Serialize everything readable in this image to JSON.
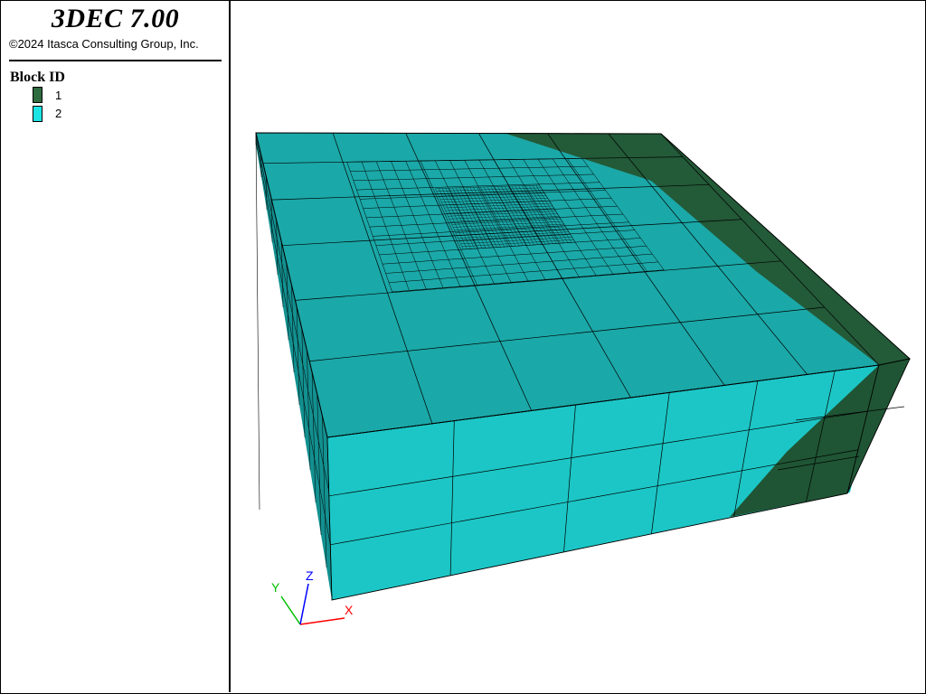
{
  "app": {
    "title": "3DEC 7.00",
    "copyright": "©2024 Itasca Consulting Group, Inc."
  },
  "legend": {
    "title": "Block  ID",
    "items": [
      {
        "label": "1",
        "color": "#2e6b3f"
      },
      {
        "label": "2",
        "color": "#1de4e4"
      }
    ]
  },
  "model": {
    "colors": {
      "block_1": "#235a38",
      "block_2_top": "#1ba8a8",
      "block_2_front": "#1cc6c6",
      "block_2_side": "#139090",
      "block_1_side": "#1f5534",
      "mesh_line": "#000000"
    }
  },
  "axes": {
    "x_label": "X",
    "y_label": "Y",
    "z_label": "Z",
    "x_color": "#ff0000",
    "y_color": "#00c000",
    "z_color": "#0000ff"
  }
}
